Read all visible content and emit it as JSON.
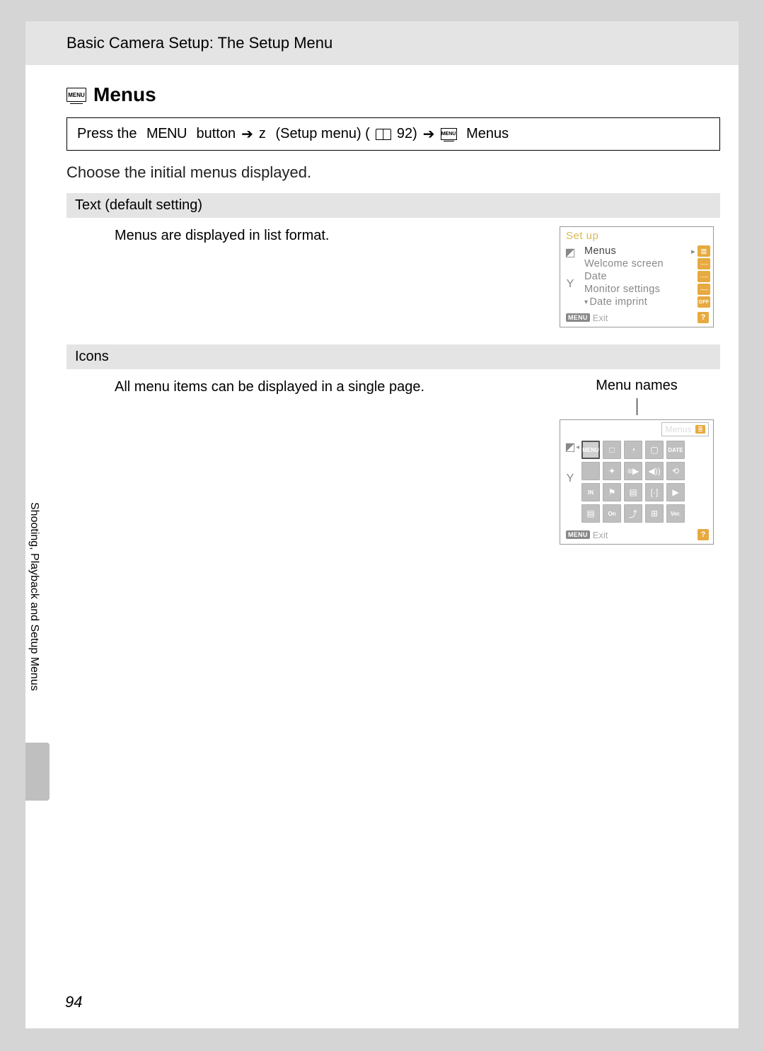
{
  "header": {
    "title": "Basic Camera Setup: The Setup Menu"
  },
  "section": {
    "icon_text": "MENU",
    "title": "Menus",
    "nav": {
      "prefix": "Press the",
      "menu_word": "MENU",
      "mid1": "button",
      "z_glyph": "z",
      "setup_text": "(Setup menu) (",
      "page_ref": "92)",
      "tail": "Menus"
    },
    "intro": "Choose the initial menus displayed."
  },
  "settings": [
    {
      "name": "Text (default setting)",
      "desc": "Menus are displayed in list format.",
      "preview": {
        "type": "list",
        "header": "Set up",
        "items": [
          {
            "label": "Menus",
            "badge": "list",
            "selected": true
          },
          {
            "label": "Welcome screen",
            "badge": "dash"
          },
          {
            "label": "Date",
            "badge": "dash"
          },
          {
            "label": "Monitor settings",
            "badge": "dash"
          },
          {
            "label": "Date imprint",
            "badge": "off"
          }
        ],
        "footer": {
          "menu": "MENU",
          "exit": "Exit",
          "help": "?"
        }
      }
    },
    {
      "name": "Icons",
      "desc": "All menu items can be displayed in a single page.",
      "caption": "Menu names",
      "preview": {
        "type": "icons",
        "head_label": "Menus",
        "grid": [
          "MENU",
          "□",
          "◔",
          "▢",
          "DATE",
          " ",
          "✦",
          "≡▶",
          "◀))",
          "⟲",
          "IN",
          "⚑",
          "▤",
          "[·]",
          "▶",
          "▤",
          "On",
          "⤴",
          "⊞",
          "Ver."
        ],
        "footer": {
          "menu": "MENU",
          "exit": "Exit",
          "help": "?"
        }
      }
    }
  ],
  "side_label": "Shooting, Playback and Setup Menus",
  "page_number": "94"
}
